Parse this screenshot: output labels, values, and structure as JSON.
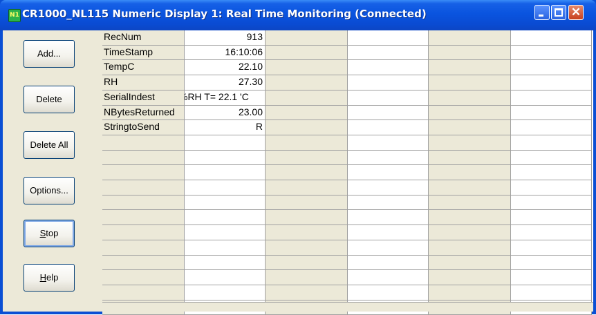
{
  "window": {
    "title": "CR1000_NL115 Numeric Display 1: Real Time Monitoring (Connected)",
    "icon_label": "N1"
  },
  "buttons": [
    {
      "label": "Add...",
      "key": "add-button"
    },
    {
      "label": "Delete",
      "key": "delete-button"
    },
    {
      "label": "Delete All",
      "key": "delete-all-button"
    },
    {
      "label": "Options...",
      "key": "options-button"
    },
    {
      "label": "Stop",
      "key": "stop-button",
      "mnemonic": "S"
    },
    {
      "label": "Help",
      "key": "help-button",
      "mnemonic": "H"
    }
  ],
  "table": {
    "rows": [
      {
        "name": "RecNum",
        "value": "913"
      },
      {
        "name": "TimeStamp",
        "value": "16:10:06"
      },
      {
        "name": "TempC",
        "value": "22.10"
      },
      {
        "name": "RH",
        "value": "27.30"
      },
      {
        "name": "SerialIndest",
        "value": "%RH T= 22.1 'C"
      },
      {
        "name": "NBytesReturned",
        "value": "23.00"
      },
      {
        "name": "StringtoSend",
        "value": "R"
      }
    ],
    "total_rows": 19,
    "column_groups": 3
  }
}
